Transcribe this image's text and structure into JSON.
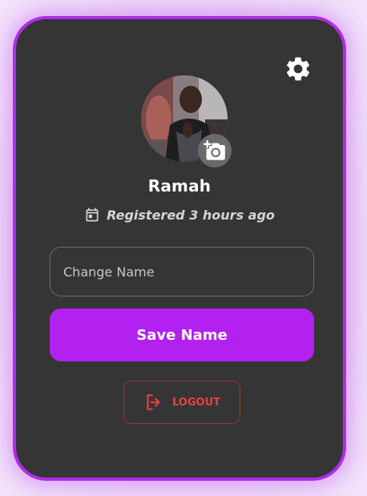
{
  "profile": {
    "username": "Ramah",
    "registered_text": "Registered 3 hours ago"
  },
  "form": {
    "name_placeholder": "Change Name",
    "name_value": "",
    "save_label": "Save Name"
  },
  "actions": {
    "logout_label": "LOGOUT"
  },
  "icons": {
    "settings": "gear-icon",
    "change_photo": "camera-plus-icon",
    "registered": "calendar-icon",
    "logout": "logout-icon"
  },
  "colors": {
    "accent": "#b221f0",
    "card_border": "#b02ce8",
    "card_background": "#353535",
    "logout": "#e8423f"
  }
}
